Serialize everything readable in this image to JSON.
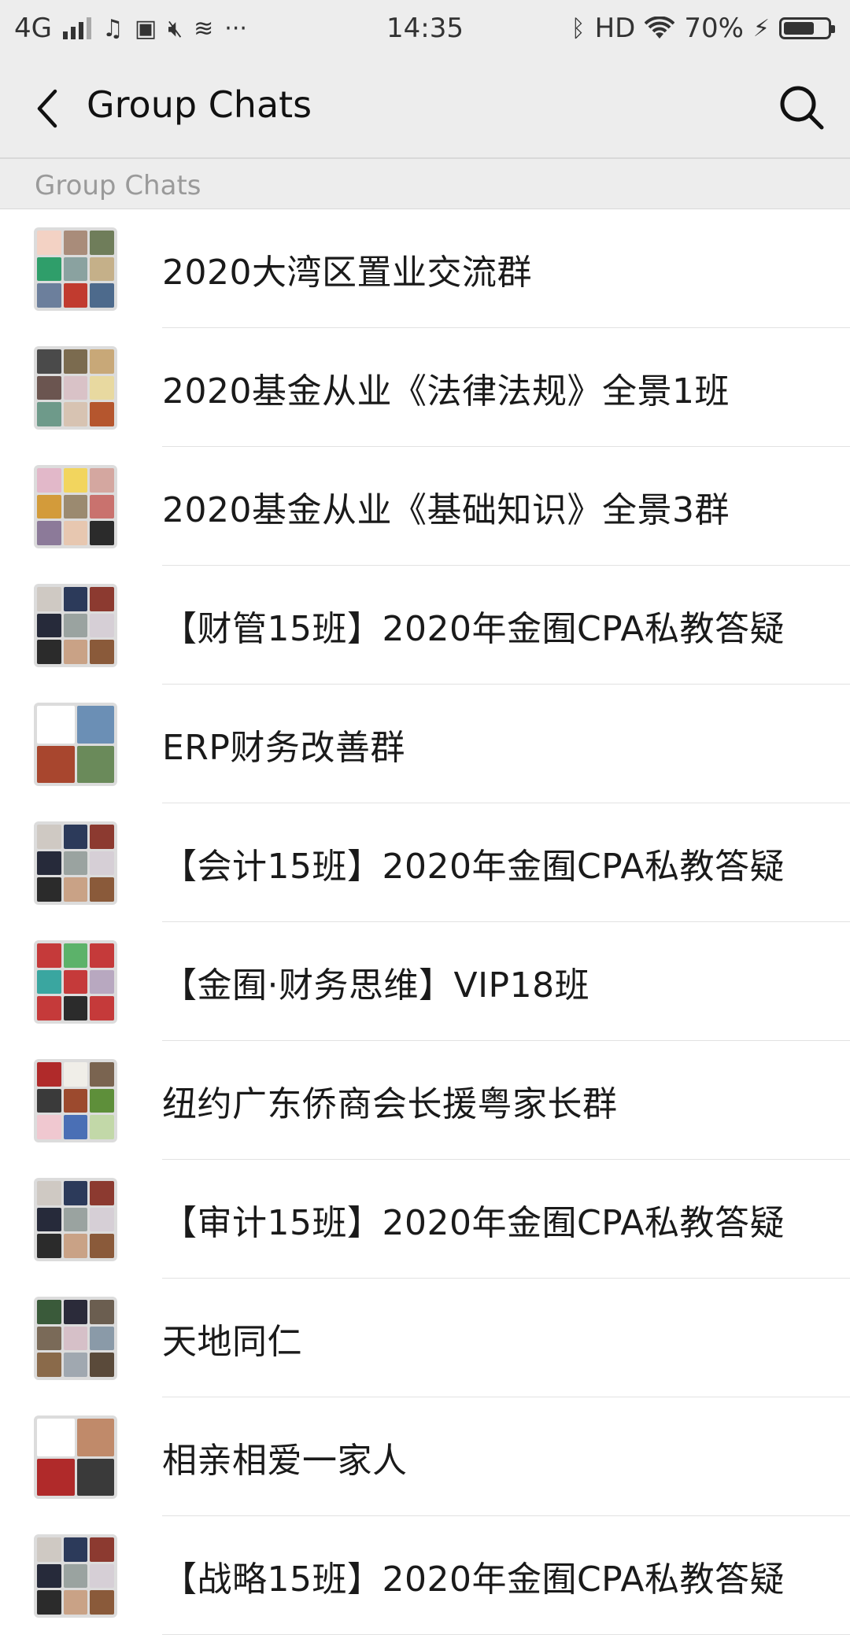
{
  "status_bar": {
    "network": "4G",
    "time": "14:35",
    "hd": "HD",
    "battery_percent": "70%",
    "battery_level": 0.7,
    "icons": [
      "signal-icon",
      "music-icon",
      "notification-icon",
      "mute-icon",
      "data-saver-icon",
      "more-dots-icon",
      "bluetooth-icon",
      "wifi-icon",
      "charging-icon",
      "battery-icon"
    ]
  },
  "navbar": {
    "title": "Group Chats",
    "back_icon": "back-chevron-icon",
    "search_icon": "search-icon"
  },
  "section_header": "Group Chats",
  "groups": [
    {
      "name": "2020大湾区置业交流群",
      "grid": 9,
      "colors": [
        "#f3d2c4",
        "#a98c7a",
        "#6f7d5a",
        "#2f9e6a",
        "#8aa2a0",
        "#c5b089",
        "#6c7f9c",
        "#c13b2f",
        "#4d6a8c"
      ]
    },
    {
      "name": "2020基金从业《法律法规》全景1班",
      "grid": 9,
      "colors": [
        "#4a4a4a",
        "#7b6b4f",
        "#c8a878",
        "#6b5550",
        "#d9c2c7",
        "#e8d9a0",
        "#6e9a8a",
        "#d7c3b2",
        "#b5562e"
      ]
    },
    {
      "name": "2020基金从业《基础知识》全景3群",
      "grid": 9,
      "colors": [
        "#e2b8c9",
        "#f2d55e",
        "#d4a7a0",
        "#d39b3a",
        "#9b8a70",
        "#c9726e",
        "#8c7a99",
        "#e7c7b0",
        "#2b2b2b"
      ]
    },
    {
      "name": "【财管15班】2020年金囿CPA私教答疑",
      "grid": 9,
      "colors": [
        "#cfc9c3",
        "#2c3a5a",
        "#8c3a30",
        "#262a3a",
        "#9aa3a0",
        "#d6cfd6",
        "#2b2b2b",
        "#c9a286",
        "#8a5a3a"
      ]
    },
    {
      "name": "ERP财务改善群",
      "grid": 4,
      "colors": [
        "#ffffff",
        "#6b8fb5",
        "#a8462e",
        "#6a8a5a"
      ]
    },
    {
      "name": "【会计15班】2020年金囿CPA私教答疑",
      "grid": 9,
      "colors": [
        "#cfc9c3",
        "#2c3a5a",
        "#8c3a30",
        "#262a3a",
        "#9aa3a0",
        "#d6cfd6",
        "#2b2b2b",
        "#c9a286",
        "#8a5a3a"
      ]
    },
    {
      "name": "【金囿·财务思维】VIP18班",
      "grid": 9,
      "colors": [
        "#c53a3a",
        "#5cb26a",
        "#c53a3a",
        "#3aa6a0",
        "#c53a3a",
        "#b8a8c0",
        "#c53a3a",
        "#2b2b2b",
        "#c53a3a"
      ]
    },
    {
      "name": "纽约广东侨商会长援粤家长群",
      "grid": 9,
      "colors": [
        "#b02a2a",
        "#f0eee8",
        "#7a6450",
        "#3a3a3a",
        "#9c4a2e",
        "#5e8f3a",
        "#f0c8d0",
        "#4a6fb5",
        "#c2d8a8"
      ]
    },
    {
      "name": "【审计15班】2020年金囿CPA私教答疑",
      "grid": 9,
      "colors": [
        "#cfc9c3",
        "#2c3a5a",
        "#8c3a30",
        "#262a3a",
        "#9aa3a0",
        "#d6cfd6",
        "#2b2b2b",
        "#c9a286",
        "#8a5a3a"
      ]
    },
    {
      "name": "天地同仁",
      "grid": 9,
      "colors": [
        "#3a5a3a",
        "#2b2b3a",
        "#6b5e50",
        "#7a6a58",
        "#d6c0c8",
        "#8a9aa8",
        "#8a6a4a",
        "#a0a8b0",
        "#5a4a3a"
      ]
    },
    {
      "name": "相亲相爱一家人",
      "grid": 4,
      "colors": [
        "#ffffff",
        "#c08a6a",
        "#b02a2a",
        "#3a3a3a"
      ]
    },
    {
      "name": "【战略15班】2020年金囿CPA私教答疑",
      "grid": 9,
      "colors": [
        "#cfc9c3",
        "#2c3a5a",
        "#8c3a30",
        "#262a3a",
        "#9aa3a0",
        "#d6cfd6",
        "#2b2b2b",
        "#c9a286",
        "#8a5a3a"
      ]
    }
  ]
}
